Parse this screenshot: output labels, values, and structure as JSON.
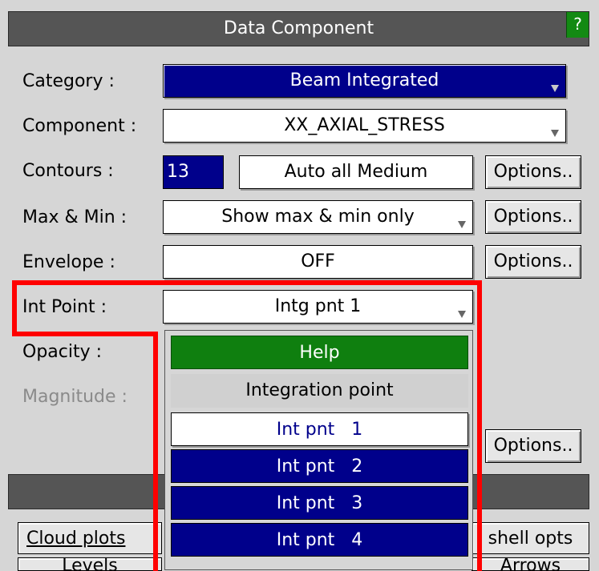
{
  "title": "Data Component",
  "help_icon": "?",
  "labels": {
    "category": "Category :",
    "component": "Component :",
    "contours": "Contours :",
    "maxmin": "Max & Min :",
    "envelope": "Envelope :",
    "int_point": "Int Point :",
    "opacity": "Opacity :",
    "magnitude": "Magnitude :"
  },
  "values": {
    "category": "Beam Integrated",
    "component": "XX_AXIAL_STRESS",
    "contours_count": "13",
    "contours_mode": "Auto all Medium",
    "maxmin": "Show max & min only",
    "envelope": "OFF",
    "int_point": "Intg pnt 1"
  },
  "buttons": {
    "options": "Options.."
  },
  "tabs": {
    "cloud_plots": "Cloud plots",
    "levels": "Levels",
    "shell_opts": "shell opts",
    "arrows": "Arrows"
  },
  "dropdown": {
    "help": "Help",
    "header": "Integration point",
    "items": [
      "Int pnt   1",
      "Int pnt   2",
      "Int pnt   3",
      "Int pnt   4"
    ],
    "selected_index": 0
  },
  "colors": {
    "highlight": "#ff0000",
    "selection_blue": "#00008b",
    "help_green": "#0f7f0f"
  }
}
